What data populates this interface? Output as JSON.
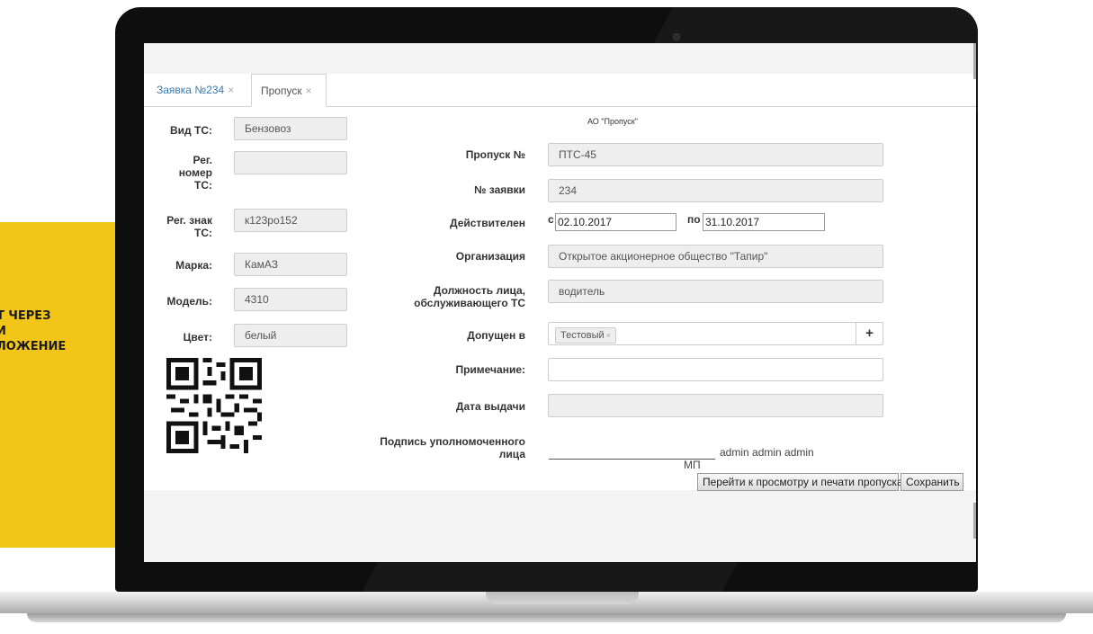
{
  "promo": {
    "text": "Т ЧЕРЕЗ\nИ\nЛОЖЕНИЕ"
  },
  "tabs": [
    {
      "label": "Заявка №234"
    },
    {
      "label": "Пропуск"
    }
  ],
  "tab_close_glyph": "×",
  "org_header": "АО \"Пропуск\"",
  "vehicle": {
    "type_label": "Вид ТС:",
    "type_value": "Бензовоз",
    "reg_number_label": "Рег.\nномер\nТС:",
    "reg_number_value": "",
    "reg_sign_label": "Рег. знак\nТС:",
    "reg_sign_value": "к123ро152",
    "brand_label": "Марка:",
    "brand_value": "КамАЗ",
    "model_label": "Модель:",
    "model_value": "4310",
    "color_label": "Цвет:",
    "color_value": "белый"
  },
  "pass": {
    "number_label": "Пропуск №",
    "number_value": "ПТС-45",
    "request_label": "№ заявки",
    "request_value": "234",
    "valid_label": "Действителен",
    "valid_from_prefix": "с",
    "valid_from": "02.10.2017",
    "valid_to_prefix": "по",
    "valid_to": "31.10.2017",
    "org_label": "Организация",
    "org_value": "Открытое акционерное общество \"Тапир\"",
    "position_label": "Должность лица,\nобслуживающего ТС",
    "position_value": "водитель",
    "admitted_label": "Допущен в",
    "admitted_chip": "Тестовый",
    "chip_close": "×",
    "add_glyph": "+",
    "note_label": "Примечание:",
    "note_value": "",
    "issue_date_label": "Дата выдачи",
    "issue_date_value": "",
    "signature_label": "Подпись уполномоченного\nлица",
    "signature_name": "admin admin admin",
    "mp": "МП"
  },
  "buttons": {
    "preview": "Перейти к просмотру и печати пропуска",
    "save": "Сохранить"
  },
  "colors": {
    "promo_bg": "#f2c618",
    "tab_link": "#337ab7",
    "field_bg": "#eeeeee"
  },
  "icons": {
    "qr": "qr-code-icon",
    "plus": "plus-icon",
    "close": "close-icon",
    "camera": "camera-icon"
  }
}
